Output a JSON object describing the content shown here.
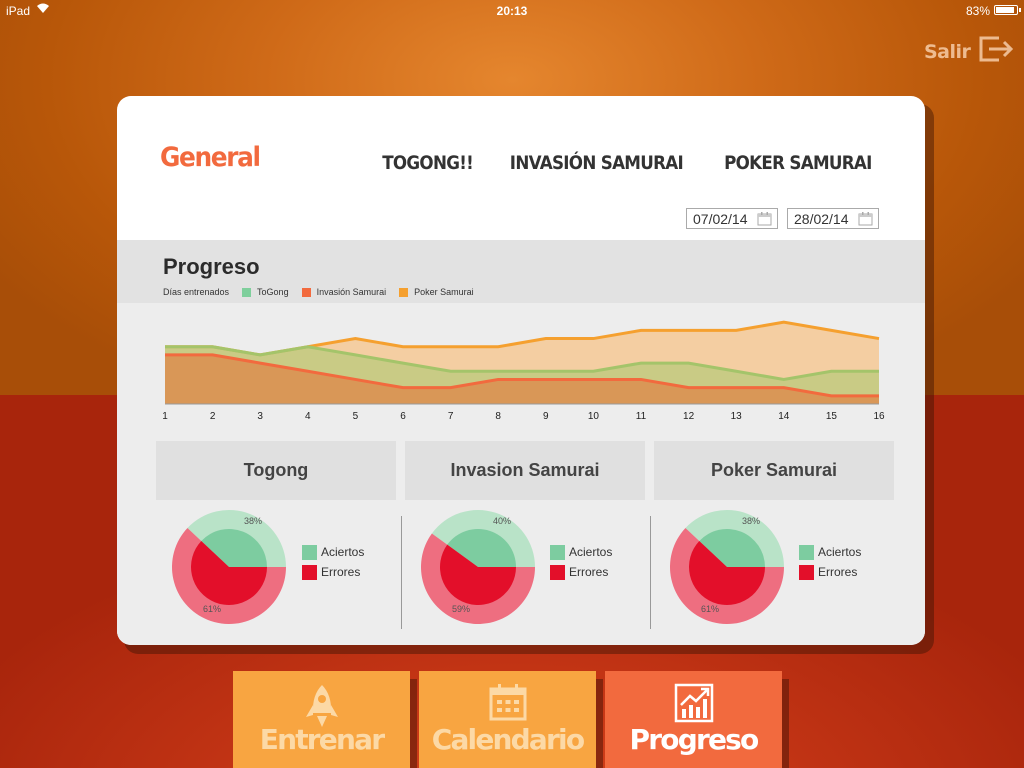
{
  "status_bar": {
    "device": "iPad",
    "time": "20:13",
    "battery": "83%"
  },
  "header": {
    "exit_label": "Salir"
  },
  "card": {
    "title": "General",
    "game_tabs": [
      "TOGONG!!",
      "INVASIÓN SAMURAI",
      "POKER SAMURAI"
    ],
    "date_from": "07/02/14",
    "date_to": "28/02/14",
    "progress": {
      "heading": "Progreso",
      "legend_label": "Días entrenados",
      "series_names": [
        "ToGong",
        "Invasión Samurai",
        "Poker Samurai"
      ]
    },
    "panels": [
      {
        "name": "Togong",
        "aciertos_pct": "38%",
        "errores_pct": "61%"
      },
      {
        "name": "Invasion Samurai",
        "aciertos_pct": "40%",
        "errores_pct": "59%"
      },
      {
        "name": "Poker Samurai",
        "aciertos_pct": "38%",
        "errores_pct": "61%"
      }
    ],
    "pie_legend": {
      "aciertos": "Aciertos",
      "errores": "Errores"
    }
  },
  "nav": {
    "entrenar": "Entrenar",
    "calendario": "Calendario",
    "progreso": "Progreso"
  },
  "colors": {
    "togong": "#7fcf9c",
    "invasion": "#f26a3e",
    "poker": "#f5a02f",
    "aciertos": "#7dcca0",
    "errores": "#e30f2a",
    "title": "#f26a3e"
  },
  "chart_data": {
    "type": "area",
    "x": [
      1,
      2,
      3,
      4,
      5,
      6,
      7,
      8,
      9,
      10,
      11,
      12,
      13,
      14,
      15,
      16
    ],
    "series": [
      {
        "name": "ToGong",
        "values": [
          7,
          7,
          6,
          7,
          6,
          5,
          4,
          4,
          4,
          4,
          5,
          5,
          4,
          3,
          4,
          4
        ]
      },
      {
        "name": "Invasión Samurai",
        "values": [
          6,
          6,
          5,
          4,
          3,
          2,
          2,
          3,
          3,
          3,
          3,
          2,
          2,
          2,
          1,
          1
        ]
      },
      {
        "name": "Poker Samurai",
        "values": [
          7,
          7,
          6,
          7,
          8,
          7,
          7,
          7,
          8,
          8,
          9,
          9,
          9,
          10,
          9,
          8
        ]
      }
    ],
    "ylim": [
      0,
      11
    ],
    "grid": false
  }
}
